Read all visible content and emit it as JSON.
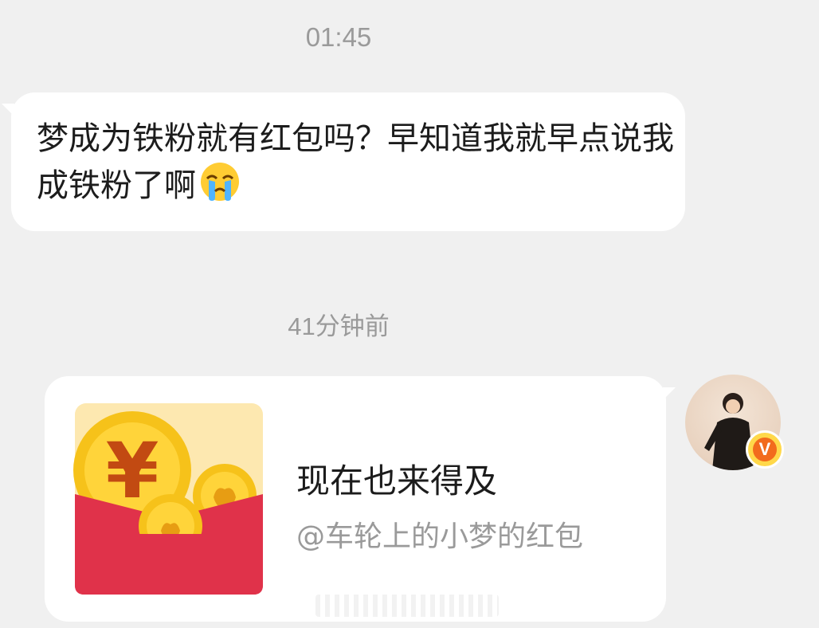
{
  "timestamps": {
    "first": "01:45",
    "second": "41分钟前"
  },
  "incoming_message": {
    "text": "梦成为铁粉就有红包吗？早知道我就早点说我成铁粉了啊",
    "emoji": "crying-emoji"
  },
  "red_packet": {
    "title": "现在也来得及",
    "subtitle": "@车轮上的小梦的红包",
    "icon": "red-envelope-icon",
    "colors": {
      "envelope": "#e0324a",
      "coin": "#f6c21a"
    }
  },
  "sender": {
    "avatar_icon": "user-avatar",
    "verified_badge": "V",
    "badge_color": "#f26b1d"
  }
}
